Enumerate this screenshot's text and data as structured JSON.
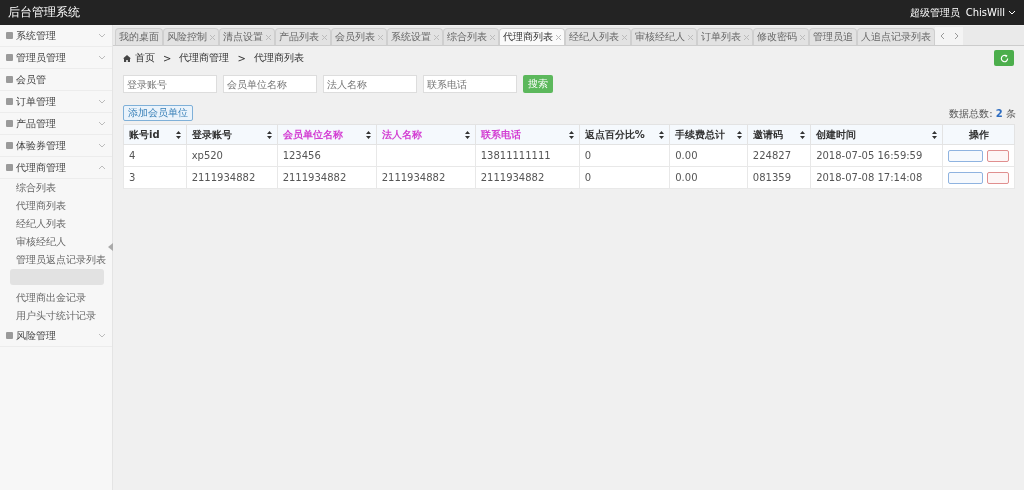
{
  "header": {
    "title": "后台管理系统",
    "role": "超级管理员",
    "user": "ChisWill"
  },
  "sidebar": {
    "items": [
      {
        "label": "系统管理",
        "expanded": false
      },
      {
        "label": "管理员管理",
        "expanded": false
      },
      {
        "label": "会员管"
      },
      {
        "label": "订单管理",
        "expanded": false
      },
      {
        "label": "产品管理",
        "expanded": false
      },
      {
        "label": "体验券管理",
        "expanded": false
      },
      {
        "label": "代理商管理",
        "expanded": true,
        "children": [
          {
            "label": "综合列表"
          },
          {
            "label": "代理商列表"
          },
          {
            "label": "经纪人列表"
          },
          {
            "label": "审核经纪人"
          },
          {
            "label": "管理员返点记录列表",
            "redacted_after": true
          },
          {
            "label": "代理商出金记录"
          },
          {
            "label": "用户头寸统计记录"
          }
        ]
      },
      {
        "label": "风险管理",
        "expanded": false
      }
    ]
  },
  "tabs": [
    {
      "label": "我的桌面",
      "selected": false,
      "closable": false
    },
    {
      "label": "风险控制",
      "selected": false,
      "closable": true
    },
    {
      "label": "清点设置",
      "selected": false,
      "closable": true
    },
    {
      "label": "产品列表",
      "selected": false,
      "closable": true
    },
    {
      "label": "会员列表",
      "selected": false,
      "closable": true
    },
    {
      "label": "系统设置",
      "selected": false,
      "closable": true
    },
    {
      "label": "综合列表",
      "selected": false,
      "closable": true
    },
    {
      "label": "代理商列表",
      "selected": true,
      "closable": true
    },
    {
      "label": "经纪人列表",
      "selected": false,
      "closable": true
    },
    {
      "label": "审核经纪人",
      "selected": false,
      "closable": true
    },
    {
      "label": "订单列表",
      "selected": false,
      "closable": true
    },
    {
      "label": "修改密码",
      "selected": false,
      "closable": true
    },
    {
      "label": "管理员追",
      "selected": false,
      "closable": false
    },
    {
      "label": "人追点记录列表",
      "selected": false,
      "closable": false
    }
  ],
  "breadcrumb": [
    {
      "label": "首页"
    },
    {
      "separator": ">",
      "label": "代理商管理"
    },
    {
      "separator": ">",
      "label": "代理商列表"
    }
  ],
  "filters": [
    {
      "placeholder": "登录账号"
    },
    {
      "placeholder": "会员单位名称"
    },
    {
      "placeholder": "法人名称"
    },
    {
      "placeholder": "联系电话"
    }
  ],
  "search_button": "搜索",
  "add_button": "添加会员单位",
  "total": {
    "label": "数据总数:",
    "count": "2",
    "unit": "条"
  },
  "table": {
    "columns": [
      {
        "label": "账号id",
        "highlighted": false,
        "sortable": true
      },
      {
        "label": "登录账号",
        "highlighted": false,
        "sortable": true
      },
      {
        "label": "会员单位名称",
        "highlighted": true,
        "sortable": true
      },
      {
        "label": "法人名称",
        "highlighted": true,
        "sortable": true
      },
      {
        "label": "联系电话",
        "highlighted": true,
        "sortable": true
      },
      {
        "label": "返点百分比%",
        "highlighted": false,
        "sortable": true
      },
      {
        "label": "手续费总计",
        "highlighted": false,
        "sortable": true
      },
      {
        "label": "邀请码",
        "highlighted": false,
        "sortable": true
      },
      {
        "label": "创建时间",
        "highlighted": false,
        "sortable": true
      },
      {
        "label": "操作",
        "highlighted": false,
        "sortable": false
      }
    ],
    "rows": [
      {
        "cells": [
          "4",
          "xp520",
          "123456",
          "",
          "13811111111",
          "0",
          "0.00",
          "224827",
          "2018-07-05 16:59:59"
        ]
      },
      {
        "cells": [
          "3",
          "2111934882",
          "2111934882",
          "2111934882",
          "2111934882",
          "0",
          "0.00",
          "081359",
          "2018-07-08 17:14:08"
        ]
      }
    ]
  }
}
